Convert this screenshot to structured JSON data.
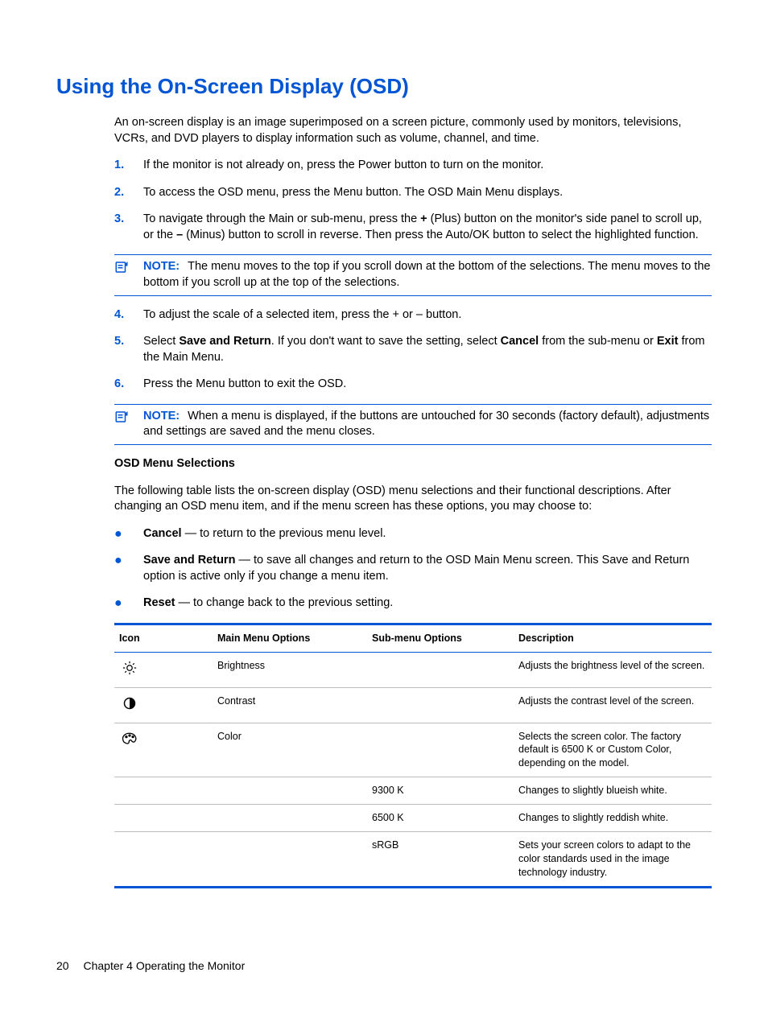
{
  "heading": "Using the On-Screen Display (OSD)",
  "intro": "An on-screen display is an image superimposed on a screen picture, commonly used by monitors, televisions, VCRs, and DVD players to display information such as volume, channel, and time.",
  "steps": {
    "s1": "If the monitor is not already on, press the Power button to turn on the monitor.",
    "s2": "To access the OSD menu, press the Menu button. The OSD Main Menu displays.",
    "s3_a": "To navigate through the Main or sub-menu, press the ",
    "s3_plus": "+",
    "s3_b": " (Plus) button on the monitor's side panel to scroll up, or the ",
    "s3_minus": "–",
    "s3_c": " (Minus) button to scroll in reverse. Then press the Auto/OK button to select the highlighted function.",
    "s4": "To adjust the scale of a selected item, press the + or – button.",
    "s5_a": "Select ",
    "s5_save": "Save and Return",
    "s5_b": ". If you don't want to save the setting, select ",
    "s5_cancel": "Cancel",
    "s5_c": " from the sub-menu or ",
    "s5_exit": "Exit",
    "s5_d": " from the Main Menu.",
    "s6": "Press the Menu button to exit the OSD."
  },
  "note_label": "NOTE:",
  "note1": "The menu moves to the top if you scroll down at the bottom of the selections. The menu moves to the bottom if you scroll up at the top of the selections.",
  "note2": "When a menu is displayed, if the buttons are untouched for 30 seconds (factory default), adjustments and settings are saved and the menu closes.",
  "subhead": "OSD Menu Selections",
  "osd_intro": "The following table lists the on-screen display (OSD) menu selections and their functional descriptions. After changing an OSD menu item, and if the menu screen has these options, you may choose to:",
  "bullets": {
    "b1_bold": "Cancel",
    "b1_rest": " — to return to the previous menu level.",
    "b2_bold": "Save and Return",
    "b2_rest": " — to save all changes and return to the OSD Main Menu screen. This Save and Return option is active only if you change a menu item.",
    "b3_bold": "Reset",
    "b3_rest": " — to change back to the previous setting."
  },
  "table": {
    "headers": {
      "icon": "Icon",
      "main": "Main Menu Options",
      "sub": "Sub-menu Options",
      "desc": "Description"
    },
    "rows": [
      {
        "icon": "brightness-icon",
        "main": "Brightness",
        "sub": "",
        "desc": "Adjusts the brightness level of the screen."
      },
      {
        "icon": "contrast-icon",
        "main": "Contrast",
        "sub": "",
        "desc": "Adjusts the contrast level of the screen."
      },
      {
        "icon": "color-icon",
        "main": "Color",
        "sub": "",
        "desc": "Selects the screen color. The factory default is 6500 K or Custom Color, depending on the model."
      },
      {
        "icon": "",
        "main": "",
        "sub": "9300 K",
        "desc": "Changes to slightly blueish white."
      },
      {
        "icon": "",
        "main": "",
        "sub": "6500 K",
        "desc": "Changes to slightly reddish white."
      },
      {
        "icon": "",
        "main": "",
        "sub": "sRGB",
        "desc": "Sets your screen colors to adapt to the color standards used in the image technology industry."
      }
    ]
  },
  "footer": {
    "page": "20",
    "chapter": "Chapter 4   Operating the Monitor"
  }
}
